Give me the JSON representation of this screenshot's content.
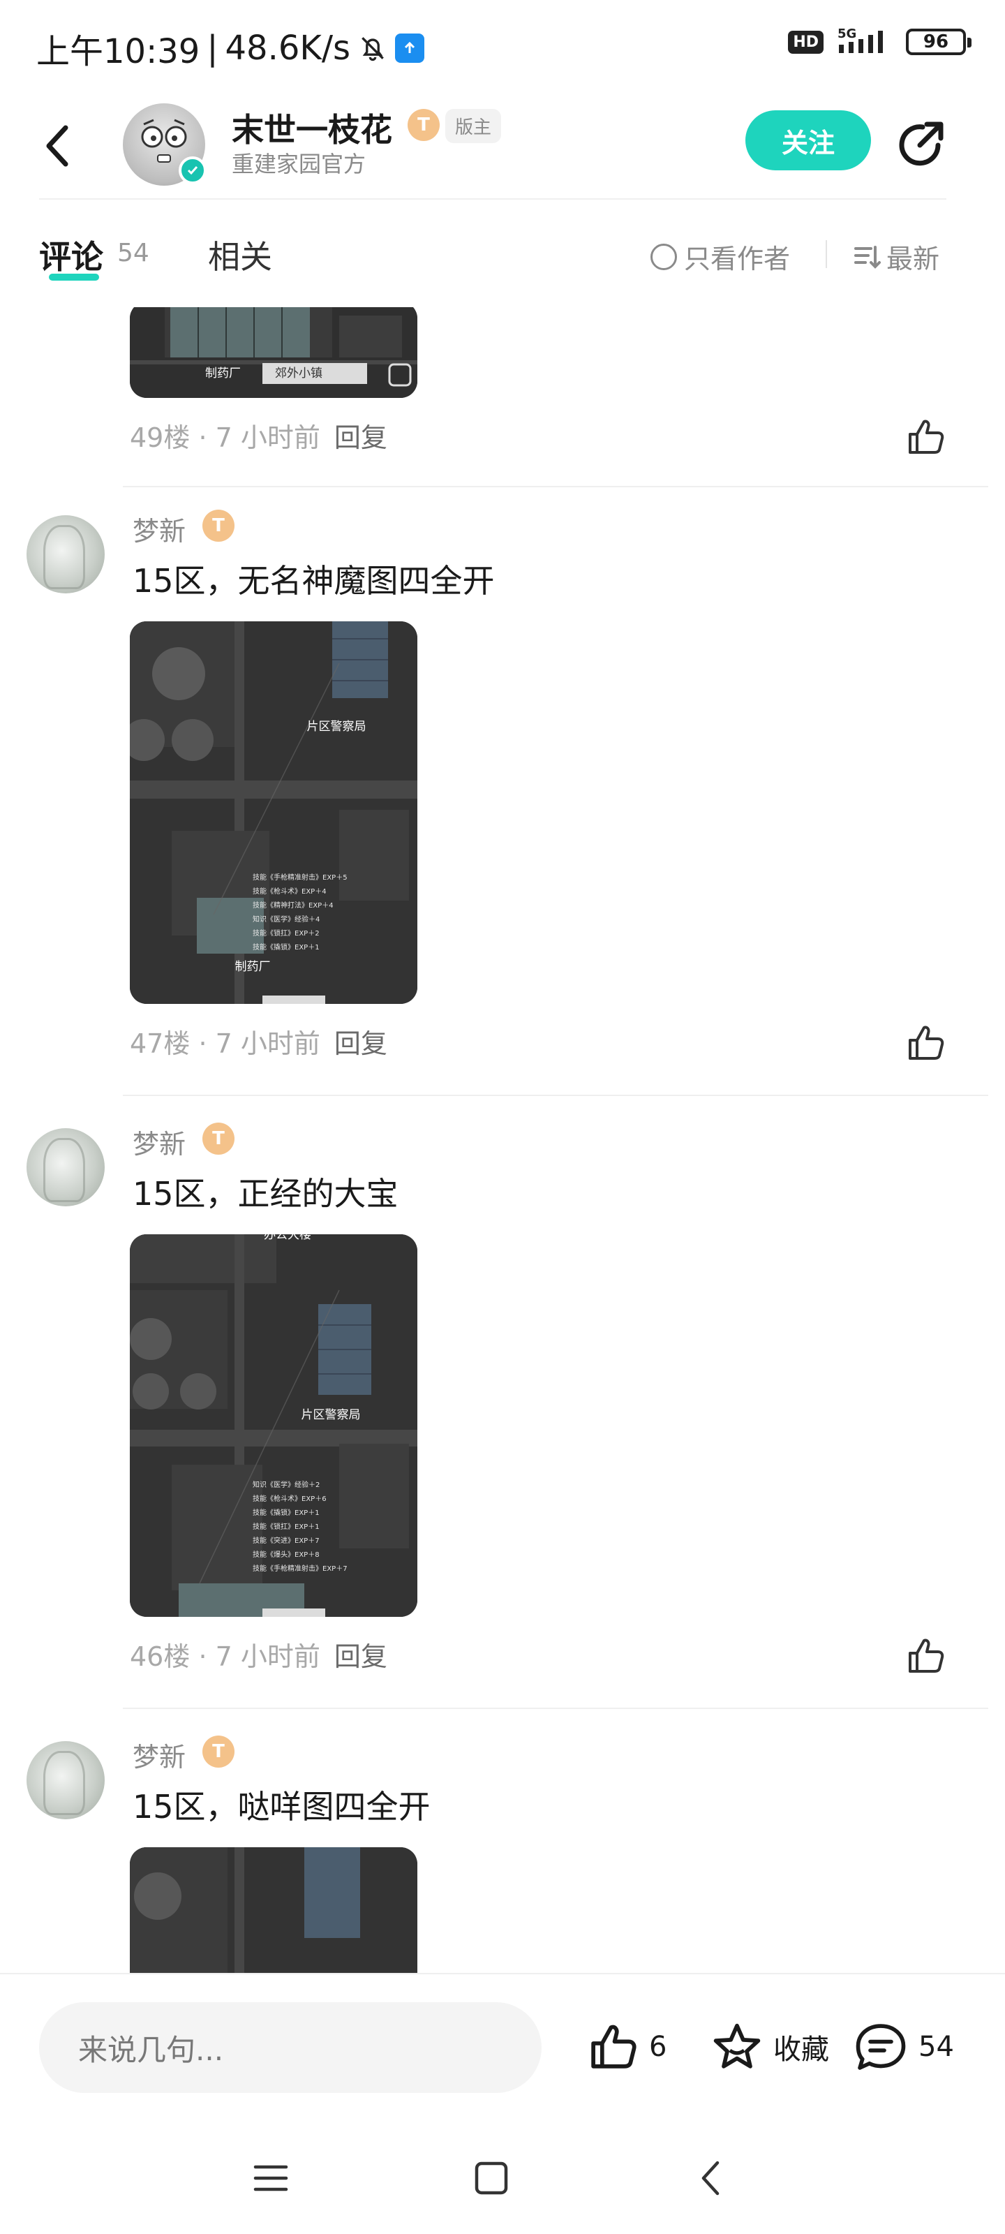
{
  "status_bar": {
    "time": "上午10:39",
    "net_speed": "48.6K/s",
    "hd": "HD",
    "signal": "5G",
    "battery": "96"
  },
  "header": {
    "board_name": "末世一枝花",
    "level": "T",
    "moderator_tag": "版主",
    "subtitle": "重建家园官方",
    "follow_label": "关注"
  },
  "tabs": {
    "comments_label": "评论",
    "comments_count": "54",
    "related_label": "相关",
    "author_only_label": "只看作者",
    "sort_label": "最新"
  },
  "comments": [
    {
      "floor": "49楼",
      "time": "7 小时前",
      "reply_label": "回复",
      "map_labels": [
        "制药厂",
        "郊外小镇"
      ]
    },
    {
      "author": "梦新",
      "level": "T",
      "text": "15区，无名神魔图四全开",
      "floor": "47楼",
      "time": "7 小时前",
      "reply_label": "回复",
      "map_labels": [
        "片区警察局",
        "制药厂"
      ],
      "exp_lines": [
        "技能《手枪精准射击》EXP＋5",
        "技能《枪斗术》EXP＋4",
        "技能《精神打法》EXP＋4",
        "知识《医学》经验＋4",
        "技能《锁扛》EXP＋2",
        "技能《撬锁》EXP＋1"
      ]
    },
    {
      "author": "梦新",
      "level": "T",
      "text": "15区，正经的大宝",
      "floor": "46楼",
      "time": "7 小时前",
      "reply_label": "回复",
      "map_labels": [
        "办公大楼",
        "片区警察局"
      ],
      "exp_lines": [
        "知识《医学》经验＋2",
        "技能《枪斗术》EXP＋6",
        "技能《撬锁》EXP＋1",
        "技能《锁扛》EXP＋1",
        "技能《突进》EXP＋7",
        "技能《爆头》EXP＋8",
        "技能《手枪精准射击》EXP＋7"
      ]
    },
    {
      "author": "梦新",
      "level": "T",
      "text": "15区，哒咩图四全开"
    }
  ],
  "bottom_bar": {
    "input_placeholder": "来说几句...",
    "like_count": "6",
    "favorite_label": "收藏",
    "comment_count": "54"
  }
}
